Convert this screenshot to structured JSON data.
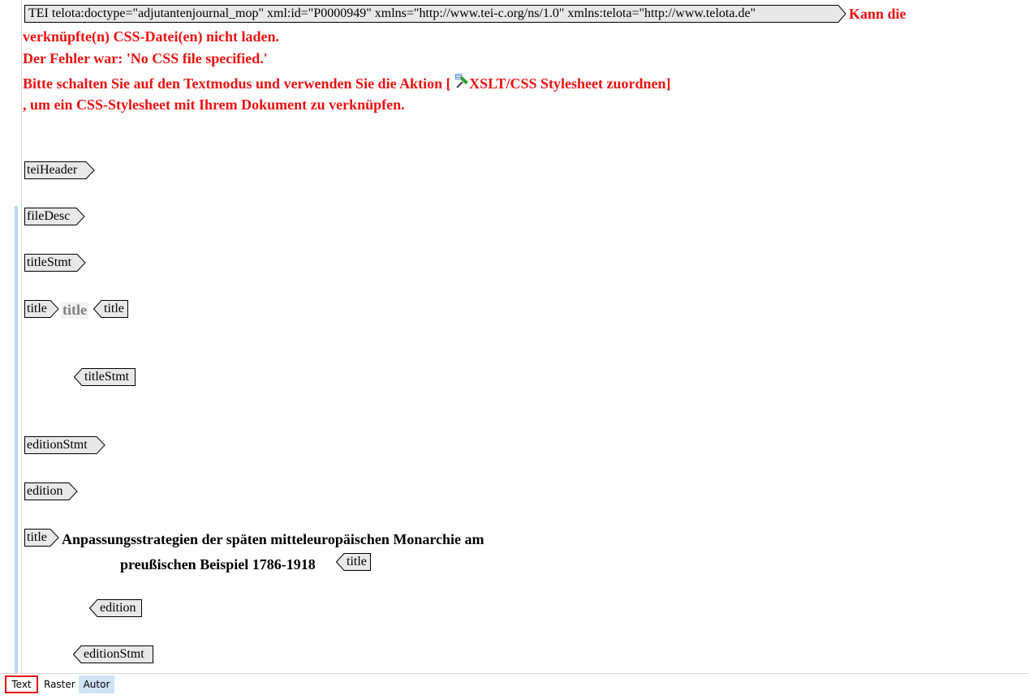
{
  "root_tag": {
    "label": "TEI telota:doctype=\"adjutantenjournal_mop\" xml:id=\"P0000949\" xmlns=\"http://www.tei-c.org/ns/1.0\" xmlns:telota=\"http://www.telota.de\""
  },
  "error": {
    "line1": "Kann die",
    "line2": "verknüpfte(n) CSS-Datei(en) nicht laden.",
    "line3": "Der Fehler war: 'No CSS file specified.'",
    "line4_prefix": "Bitte schalten Sie auf den Textmodus und verwenden Sie die Aktion [",
    "line4_action": "XSLT/CSS Stylesheet zuordnen]",
    "line5": ", um ein CSS-Stylesheet mit Ihrem Dokument zu verknüpfen."
  },
  "tags": {
    "teiHeader": "teiHeader",
    "fileDesc": "fileDesc",
    "titleStmt_open": "titleStmt",
    "title_open": "title",
    "title_placeholder": "title",
    "title_close": "title",
    "titleStmt_close": "titleStmt",
    "editionStmt_open": "editionStmt",
    "edition_open": "edition",
    "title2_open": "title",
    "title2_close": "title",
    "edition_close": "edition",
    "editionStmt_close": "editionStmt"
  },
  "content": {
    "title_line1": "Anpassungsstrategien der späten mitteleuropäischen Monarchie am",
    "title_line2": "preußischen Beispiel 1786-1918"
  },
  "tabs": {
    "text": "Text",
    "raster": "Raster",
    "autor": "Autor",
    "active": "Autor"
  },
  "colors": {
    "error_red": "#ee1111",
    "tag_bg": "#e8e8e8",
    "active_tab": "#cfe3f7",
    "highlight_border": "#e01010"
  }
}
